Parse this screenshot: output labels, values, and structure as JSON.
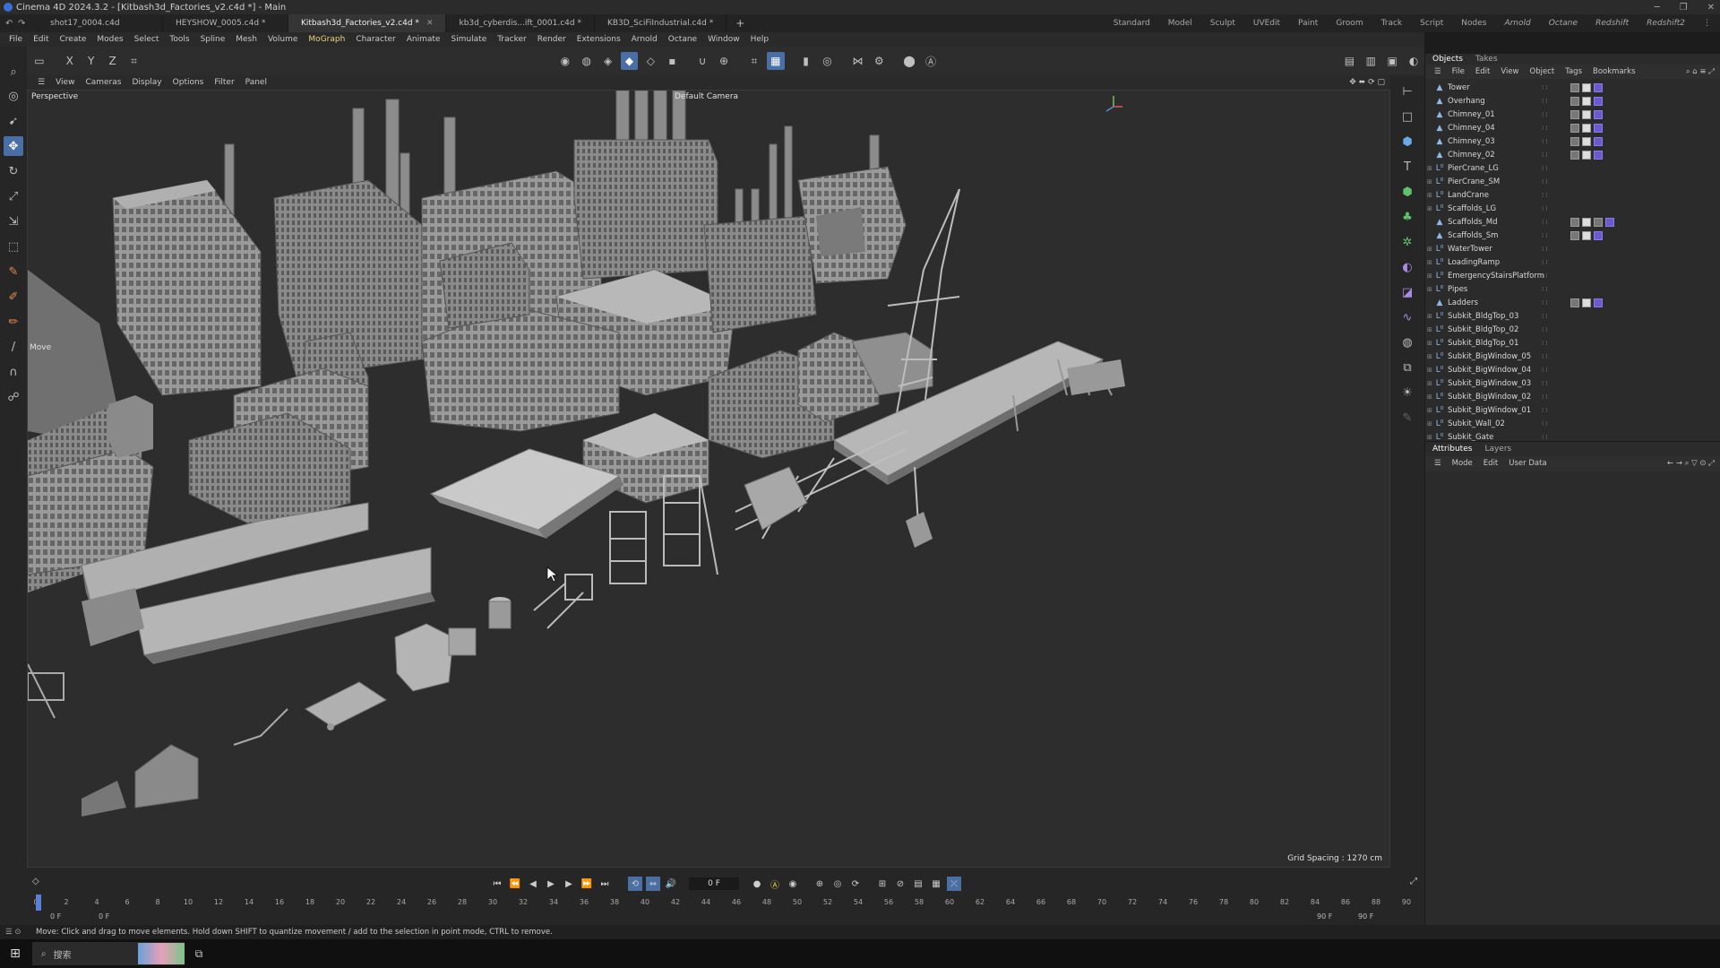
{
  "window": {
    "title": "Cinema 4D 2024.3.2 - [Kitbash3d_Factories_v2.c4d *] - Main",
    "controls": [
      "─",
      "❐",
      "✕"
    ]
  },
  "tabs": [
    {
      "label": "shot17_0004.c4d"
    },
    {
      "label": "HEYSHOW_0005.c4d *"
    },
    {
      "label": "Kitbash3d_Factories_v2.c4d *",
      "active": true
    },
    {
      "label": "kb3d_cyberdis...ift_0001.c4d *"
    },
    {
      "label": "KB3D_SciFiIndustrial.c4d *"
    }
  ],
  "add_tab": "+",
  "layouts": [
    "Standard",
    "Model",
    "Sculpt",
    "UVEdit",
    "Paint",
    "Groom",
    "Track",
    "Script",
    "Nodes",
    "Arnold",
    "Octane",
    "Redshift",
    "Redshift2"
  ],
  "menu": [
    "File",
    "Edit",
    "Create",
    "Modes",
    "Select",
    "Tools",
    "Spline",
    "Mesh",
    "Volume",
    "MoGraph",
    "Character",
    "Animate",
    "Simulate",
    "Tracker",
    "Render",
    "Extensions",
    "Arnold",
    "Octane",
    "Window",
    "Help"
  ],
  "axis_toggles": [
    "X",
    "Y",
    "Z"
  ],
  "viewport": {
    "menu": [
      "View",
      "Cameras",
      "Display",
      "Options",
      "Filter",
      "Panel"
    ],
    "projection": "Perspective",
    "camera": "Default Camera",
    "hud_tool": "Move",
    "grid_spacing": "Grid Spacing : 1270 cm"
  },
  "objects_panel": {
    "tabs": [
      "Objects",
      "Takes"
    ],
    "menu": [
      "File",
      "Edit",
      "View",
      "Object",
      "Tags",
      "Bookmarks"
    ],
    "items": [
      {
        "name": "Tower",
        "type": "mesh",
        "tags": 3
      },
      {
        "name": "Overhang",
        "type": "mesh",
        "tags": 3
      },
      {
        "name": "Chimney_01",
        "type": "mesh",
        "tags": 3
      },
      {
        "name": "Chimney_04",
        "type": "mesh",
        "tags": 3
      },
      {
        "name": "Chimney_03",
        "type": "mesh",
        "tags": 3
      },
      {
        "name": "Chimney_02",
        "type": "mesh",
        "tags": 3
      },
      {
        "name": "PierCrane_LG",
        "type": "null",
        "tags": 0
      },
      {
        "name": "PierCrane_SM",
        "type": "null",
        "tags": 0
      },
      {
        "name": "LandCrane",
        "type": "null",
        "tags": 0
      },
      {
        "name": "Scaffolds_LG",
        "type": "null",
        "tags": 0
      },
      {
        "name": "Scaffolds_Md",
        "type": "mesh",
        "tags": 4
      },
      {
        "name": "Scaffolds_Sm",
        "type": "mesh",
        "tags": 3
      },
      {
        "name": "WaterTower",
        "type": "null",
        "tags": 0
      },
      {
        "name": "LoadingRamp",
        "type": "null",
        "tags": 0
      },
      {
        "name": "EmergencyStairsPlatform",
        "type": "null",
        "tags": 0
      },
      {
        "name": "Pipes",
        "type": "null",
        "tags": 0
      },
      {
        "name": "Ladders",
        "type": "mesh",
        "tags": 3
      },
      {
        "name": "Subkit_BldgTop_03",
        "type": "null",
        "tags": 0
      },
      {
        "name": "Subkit_BldgTop_02",
        "type": "null",
        "tags": 0
      },
      {
        "name": "Subkit_BldgTop_01",
        "type": "null",
        "tags": 0
      },
      {
        "name": "Subkit_BigWindow_05",
        "type": "null",
        "tags": 0
      },
      {
        "name": "Subkit_BigWindow_04",
        "type": "null",
        "tags": 0
      },
      {
        "name": "Subkit_BigWindow_03",
        "type": "null",
        "tags": 0
      },
      {
        "name": "Subkit_BigWindow_02",
        "type": "null",
        "tags": 0
      },
      {
        "name": "Subkit_BigWindow_01",
        "type": "null",
        "tags": 0
      },
      {
        "name": "Subkit_Wall_02",
        "type": "null",
        "tags": 0
      },
      {
        "name": "Subkit_Gate",
        "type": "null",
        "tags": 0
      }
    ]
  },
  "attributes_panel": {
    "tabs": [
      "Attributes",
      "Layers"
    ],
    "menu": [
      "Mode",
      "Edit",
      "User Data"
    ]
  },
  "timeline": {
    "current_frame": "0 F",
    "ticks": [
      0,
      2,
      4,
      6,
      8,
      10,
      12,
      14,
      16,
      18,
      20,
      22,
      24,
      26,
      28,
      30,
      32,
      34,
      36,
      38,
      40,
      42,
      44,
      46,
      48,
      50,
      52,
      54,
      56,
      58,
      60,
      62,
      64,
      66,
      68,
      70,
      72,
      74,
      76,
      78,
      80,
      82,
      84,
      86,
      88,
      90
    ],
    "start_a": "0 F",
    "start_b": "0 F",
    "end_a": "90 F",
    "end_b": "90 F"
  },
  "status": "Move: Click and drag to move elements. Hold down SHIFT to quantize movement / add to the selection in point mode, CTRL to remove.",
  "taskbar": {
    "search_placeholder": "搜索"
  },
  "colors": {
    "accent": "#4a6fa5",
    "menu_highlight": "#e8d27a",
    "tag_purple": "#6a5acd"
  }
}
